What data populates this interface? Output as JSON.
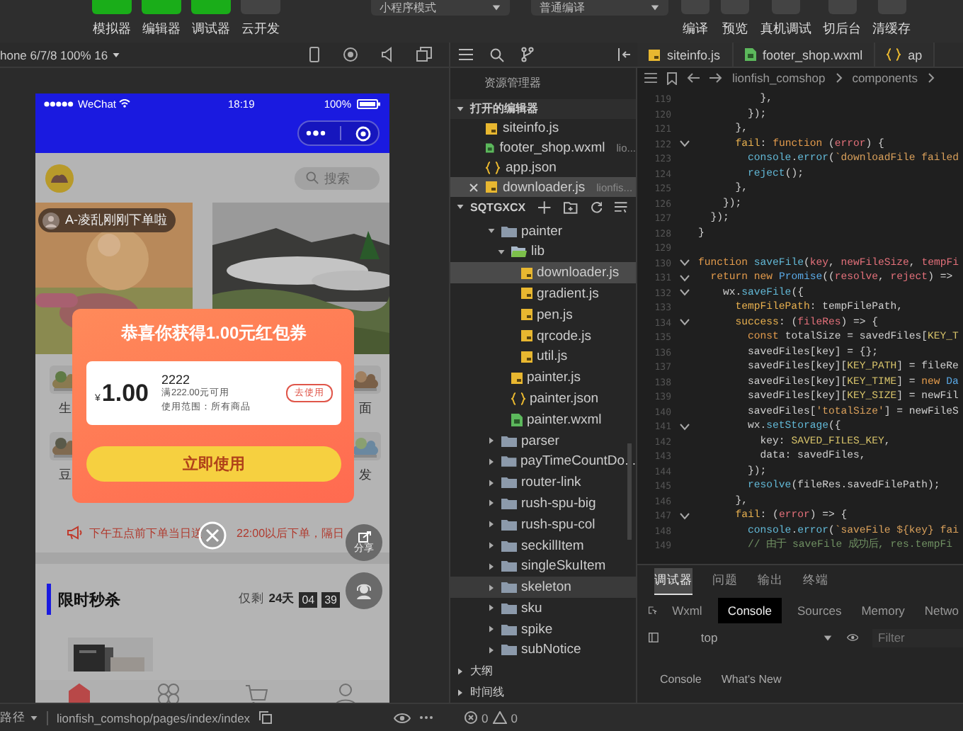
{
  "toolbar": {
    "view_toggles": [
      {
        "label": "模拟器",
        "on": true
      },
      {
        "label": "编辑器",
        "on": true
      },
      {
        "label": "调试器",
        "on": true
      },
      {
        "label": "云开发",
        "on": false
      }
    ],
    "mode_select": "小程序模式",
    "compile_select": "普通编译",
    "actions": [
      "编译",
      "预览",
      "真机调试",
      "切后台",
      "清缓存"
    ]
  },
  "simulator": {
    "device_select": "hone 6/7/8 100% 16",
    "phone": {
      "carrier": "WeChat",
      "time": "18:19",
      "battery": "100%",
      "search": {
        "placeholder": "搜索"
      },
      "order_notice": "A-凌乱刚刚下单啦",
      "categories": [
        {
          "label": "生"
        },
        {
          "label": "面"
        },
        {
          "label": "豆"
        },
        {
          "label": "发"
        }
      ],
      "delivery_notice": [
        "下午五点前下单当日送",
        "22:00以后下单，隔日"
      ],
      "share_label": "分享",
      "flash_sale": {
        "title": "限时秒杀",
        "remain_label": "仅剩",
        "days": "24天",
        "hours": "04",
        "minutes": "39"
      },
      "tabbar": [
        {
          "kind": "home",
          "selected": true
        },
        {
          "kind": "category",
          "selected": false
        },
        {
          "kind": "cart",
          "selected": false
        },
        {
          "kind": "user",
          "selected": false
        }
      ],
      "coupon_popup": {
        "title": "恭喜你获得1.00元红包券",
        "currency": "¥",
        "amount": "1.00",
        "name": "2222",
        "condition": "满222.00元可用",
        "scope": "使用范围：所有商品",
        "use_button": "去使用",
        "primary_button": "立即使用"
      }
    }
  },
  "editor_tabs": [
    {
      "label": "siteinfo.js",
      "kind": "js"
    },
    {
      "label": "footer_shop.wxml",
      "kind": "wxml"
    },
    {
      "label": "ap",
      "kind": "json"
    }
  ],
  "explorer": {
    "title": "资源管理器",
    "open_editors": {
      "label": "打开的编辑器",
      "expanded": true,
      "items": [
        {
          "name": "siteinfo.js",
          "kind": "js",
          "selected": false
        },
        {
          "name": "footer_shop.wxml",
          "kind": "wxml",
          "path": "lio...",
          "selected": false
        },
        {
          "name": "app.json",
          "kind": "json",
          "selected": false
        },
        {
          "name": "downloader.js",
          "kind": "js",
          "path": "lionfis...",
          "selected": true
        }
      ]
    },
    "project": {
      "label": "SQTGXCX",
      "expanded": true,
      "tree": [
        {
          "name": "painter",
          "kind": "folder",
          "expanded": true,
          "selected": false,
          "hovered": false,
          "children": [
            {
              "name": "lib",
              "kind": "lib",
              "expanded": true,
              "selected": false,
              "hovered": false,
              "children": [
                {
                  "name": "downloader.js",
                  "kind": "js",
                  "selected": true,
                  "hovered": false
                },
                {
                  "name": "gradient.js",
                  "kind": "js",
                  "selected": false,
                  "hovered": false
                },
                {
                  "name": "pen.js",
                  "kind": "js",
                  "selected": false,
                  "hovered": false
                },
                {
                  "name": "qrcode.js",
                  "kind": "js",
                  "selected": false,
                  "hovered": false
                },
                {
                  "name": "util.js",
                  "kind": "js",
                  "selected": false,
                  "hovered": false
                }
              ]
            },
            {
              "name": "painter.js",
              "kind": "js",
              "selected": false,
              "hovered": false
            },
            {
              "name": "painter.json",
              "kind": "json",
              "selected": false,
              "hovered": false
            },
            {
              "name": "painter.wxml",
              "kind": "wxml",
              "selected": false,
              "hovered": false
            }
          ]
        },
        {
          "name": "parser",
          "kind": "folder",
          "expanded": false,
          "selected": false,
          "hovered": false
        },
        {
          "name": "payTimeCountDo...",
          "kind": "folder",
          "expanded": false,
          "selected": false,
          "hovered": false
        },
        {
          "name": "router-link",
          "kind": "folder",
          "expanded": false,
          "selected": false,
          "hovered": false
        },
        {
          "name": "rush-spu-big",
          "kind": "folder",
          "expanded": false,
          "selected": false,
          "hovered": false
        },
        {
          "name": "rush-spu-col",
          "kind": "folder",
          "expanded": false,
          "selected": false,
          "hovered": false
        },
        {
          "name": "seckillItem",
          "kind": "folder",
          "expanded": false,
          "selected": false,
          "hovered": false
        },
        {
          "name": "singleSkuItem",
          "kind": "folder",
          "expanded": false,
          "selected": false,
          "hovered": false
        },
        {
          "name": "skeleton",
          "kind": "folder",
          "expanded": false,
          "selected": false,
          "hovered": true
        },
        {
          "name": "sku",
          "kind": "folder",
          "expanded": false,
          "selected": false,
          "hovered": false
        },
        {
          "name": "spike",
          "kind": "folder",
          "expanded": false,
          "selected": false,
          "hovered": false
        },
        {
          "name": "subNotice",
          "kind": "folder",
          "expanded": false,
          "selected": false,
          "hovered": false
        }
      ]
    },
    "sections": [
      {
        "label": "大纲",
        "expanded": false
      },
      {
        "label": "时间线",
        "expanded": false
      }
    ]
  },
  "editor": {
    "breadcrumb": [
      "lionfish_comshop",
      "components"
    ],
    "lines": [
      {
        "number": "119",
        "fold": false,
        "tokens": [
          {
            "text": "          },",
            "kind": "plain"
          }
        ]
      },
      {
        "number": "120",
        "fold": false,
        "tokens": [
          {
            "text": "        });",
            "kind": "plain"
          }
        ]
      },
      {
        "number": "121",
        "fold": false,
        "tokens": [
          {
            "text": "      },",
            "kind": "plain"
          }
        ]
      },
      {
        "number": "122",
        "fold": true,
        "tokens": [
          {
            "text": "      fail",
            "kind": "prop"
          },
          {
            "text": ": ",
            "kind": "plain"
          },
          {
            "text": "function",
            "kind": "kw"
          },
          {
            "text": " (",
            "kind": "plain"
          },
          {
            "text": "error",
            "kind": "param"
          },
          {
            "text": ") {",
            "kind": "plain"
          }
        ]
      },
      {
        "number": "123",
        "fold": false,
        "tokens": [
          {
            "text": "        console",
            "kind": "fn"
          },
          {
            "text": ".",
            "kind": "plain"
          },
          {
            "text": "error",
            "kind": "fn"
          },
          {
            "text": "(",
            "kind": "plain"
          },
          {
            "text": "`downloadFile failed",
            "kind": "str"
          }
        ]
      },
      {
        "number": "124",
        "fold": false,
        "tokens": [
          {
            "text": "        reject",
            "kind": "fn"
          },
          {
            "text": "();",
            "kind": "plain"
          }
        ]
      },
      {
        "number": "125",
        "fold": false,
        "tokens": [
          {
            "text": "      },",
            "kind": "plain"
          }
        ]
      },
      {
        "number": "126",
        "fold": false,
        "tokens": [
          {
            "text": "    });",
            "kind": "plain"
          }
        ]
      },
      {
        "number": "127",
        "fold": false,
        "tokens": [
          {
            "text": "  });",
            "kind": "plain"
          }
        ]
      },
      {
        "number": "128",
        "fold": false,
        "tokens": [
          {
            "text": "}",
            "kind": "plain"
          }
        ]
      },
      {
        "number": "129",
        "fold": false
      },
      {
        "number": "130",
        "fold": true,
        "tokens": [
          {
            "text": "function ",
            "kind": "kw"
          },
          {
            "text": "saveFile",
            "kind": "fn"
          },
          {
            "text": "(",
            "kind": "plain"
          },
          {
            "text": "key",
            "kind": "param"
          },
          {
            "text": ", ",
            "kind": "plain"
          },
          {
            "text": "newFileSize",
            "kind": "param"
          },
          {
            "text": ", ",
            "kind": "plain"
          },
          {
            "text": "tempFi",
            "kind": "param"
          }
        ]
      },
      {
        "number": "131",
        "fold": true,
        "tokens": [
          {
            "text": "  return new ",
            "kind": "kw"
          },
          {
            "text": "Promise",
            "kind": "cls"
          },
          {
            "text": "((",
            "kind": "plain"
          },
          {
            "text": "resolve",
            "kind": "param"
          },
          {
            "text": ", ",
            "kind": "plain"
          },
          {
            "text": "reject",
            "kind": "param"
          },
          {
            "text": ") =>",
            "kind": "plain"
          }
        ]
      },
      {
        "number": "132",
        "fold": true,
        "tokens": [
          {
            "text": "    wx.",
            "kind": "plain"
          },
          {
            "text": "saveFile",
            "kind": "fn"
          },
          {
            "text": "({",
            "kind": "plain"
          }
        ]
      },
      {
        "number": "133",
        "fold": false,
        "tokens": [
          {
            "text": "      tempFilePath",
            "kind": "prop"
          },
          {
            "text": ": tempFilePath,",
            "kind": "plain"
          }
        ]
      },
      {
        "number": "134",
        "fold": true,
        "tokens": [
          {
            "text": "      success",
            "kind": "prop"
          },
          {
            "text": ": (",
            "kind": "plain"
          },
          {
            "text": "fileRes",
            "kind": "param"
          },
          {
            "text": ") => {",
            "kind": "plain"
          }
        ]
      },
      {
        "number": "135",
        "fold": false,
        "tokens": [
          {
            "text": "        const",
            "kind": "kw"
          },
          {
            "text": " totalSize = savedFiles[",
            "kind": "plain"
          },
          {
            "text": "KEY_T",
            "kind": "const"
          }
        ]
      },
      {
        "number": "136",
        "fold": false,
        "tokens": [
          {
            "text": "        savedFiles[key] = {};",
            "kind": "plain"
          }
        ]
      },
      {
        "number": "137",
        "fold": false,
        "tokens": [
          {
            "text": "        savedFiles[key][",
            "kind": "plain"
          },
          {
            "text": "KEY_PATH",
            "kind": "const"
          },
          {
            "text": "] = fileRe",
            "kind": "plain"
          }
        ]
      },
      {
        "number": "138",
        "fold": false,
        "tokens": [
          {
            "text": "        savedFiles[key][",
            "kind": "plain"
          },
          {
            "text": "KEY_TIME",
            "kind": "const"
          },
          {
            "text": "] = ",
            "kind": "plain"
          },
          {
            "text": "new",
            "kind": "kw"
          },
          {
            "text": " Da",
            "kind": "cls"
          }
        ]
      },
      {
        "number": "139",
        "fold": false,
        "tokens": [
          {
            "text": "        savedFiles[key][",
            "kind": "plain"
          },
          {
            "text": "KEY_SIZE",
            "kind": "const"
          },
          {
            "text": "] = newFil",
            "kind": "plain"
          }
        ]
      },
      {
        "number": "140",
        "fold": false,
        "tokens": [
          {
            "text": "        savedFiles[",
            "kind": "plain"
          },
          {
            "text": "'totalSize'",
            "kind": "str"
          },
          {
            "text": "] = newFileS",
            "kind": "plain"
          }
        ]
      },
      {
        "number": "141",
        "fold": true,
        "tokens": [
          {
            "text": "        wx.",
            "kind": "plain"
          },
          {
            "text": "setStorage",
            "kind": "fn"
          },
          {
            "text": "({",
            "kind": "plain"
          }
        ]
      },
      {
        "number": "142",
        "fold": false,
        "tokens": [
          {
            "text": "          key: ",
            "kind": "plain"
          },
          {
            "text": "SAVED_FILES_KEY",
            "kind": "const"
          },
          {
            "text": ",",
            "kind": "plain"
          }
        ]
      },
      {
        "number": "143",
        "fold": false,
        "tokens": [
          {
            "text": "          data: savedFiles,",
            "kind": "plain"
          }
        ]
      },
      {
        "number": "144",
        "fold": false,
        "tokens": [
          {
            "text": "        });",
            "kind": "plain"
          }
        ]
      },
      {
        "number": "145",
        "fold": false,
        "tokens": [
          {
            "text": "        resolve",
            "kind": "fn"
          },
          {
            "text": "(fileRes.savedFilePath);",
            "kind": "plain"
          }
        ]
      },
      {
        "number": "146",
        "fold": false,
        "tokens": [
          {
            "text": "      },",
            "kind": "plain"
          }
        ]
      },
      {
        "number": "147",
        "fold": true,
        "tokens": [
          {
            "text": "      fail",
            "kind": "prop"
          },
          {
            "text": ": (",
            "kind": "plain"
          },
          {
            "text": "error",
            "kind": "param"
          },
          {
            "text": ") => {",
            "kind": "plain"
          }
        ]
      },
      {
        "number": "148",
        "fold": false,
        "tokens": [
          {
            "text": "        console",
            "kind": "fn"
          },
          {
            "text": ".",
            "kind": "plain"
          },
          {
            "text": "error",
            "kind": "fn"
          },
          {
            "text": "(",
            "kind": "plain"
          },
          {
            "text": "`saveFile ${key} fai",
            "kind": "str"
          }
        ]
      },
      {
        "number": "149",
        "fold": false,
        "tokens": [
          {
            "text": "        // 由于 saveFile 成功后, res.tempFi",
            "kind": "comment"
          }
        ]
      }
    ]
  },
  "devtools": {
    "tabs": [
      {
        "label": "调试器",
        "selected": true
      },
      {
        "label": "问题",
        "selected": false
      },
      {
        "label": "输出",
        "selected": false
      },
      {
        "label": "终端",
        "selected": false
      }
    ],
    "panel_tabs": [
      {
        "label": "Wxml",
        "selected": false
      },
      {
        "label": "Console",
        "selected": true
      },
      {
        "label": "Sources",
        "selected": false
      },
      {
        "label": "Memory",
        "selected": false
      },
      {
        "label": "Netwo",
        "selected": false
      }
    ],
    "context_select": "top",
    "filter": {
      "placeholder": "Filter"
    },
    "drawer_tabs": [
      "Console",
      "What's New"
    ]
  },
  "status_bar": {
    "path_label": "路径",
    "path": "lionfish_comshop/pages/index/index",
    "errors": "0",
    "warnings": "0"
  }
}
